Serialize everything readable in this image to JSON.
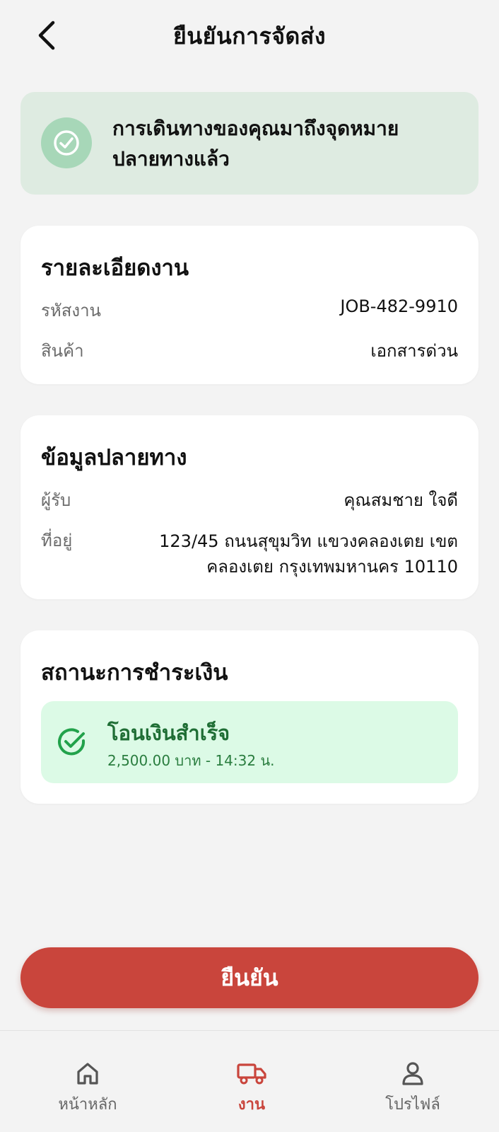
{
  "header": {
    "title": "ยืนยันการจัดส่ง",
    "back_icon": "chevron-left-icon"
  },
  "banner": {
    "icon": "check-circle-icon",
    "message": "การเดินทางของคุณมาถึงจุดหมายปลายทางแล้ว",
    "bg_color": "#deebe1"
  },
  "job_details": {
    "title": "รายละเอียดงาน",
    "rows": [
      {
        "label": "รหัสงาน",
        "value": "JOB-482-9910"
      },
      {
        "label": "สินค้า",
        "value": "เอกสารด่วน"
      }
    ]
  },
  "destination": {
    "title": "ข้อมูลปลายทาง",
    "recipient_label": "ผู้รับ",
    "recipient_value": "คุณสมชาย ใจดี",
    "address_label": "ที่อยู่",
    "address_value": "123/45 ถนนสุขุมวิท แขวงคลองเตย เขตคลองเตย กรุงเทพมหานคร 10110"
  },
  "payment": {
    "title": "สถานะการชำระเงิน",
    "status_icon": "check-circle-icon",
    "status_title": "โอนเงินสำเร็จ",
    "status_detail": "2,500.00 บาท - 14:32 น.",
    "status_color": "#1f6e35"
  },
  "confirm_button": {
    "label": "ยืนยัน",
    "color": "#c9453c"
  },
  "bottom_nav": {
    "items": [
      {
        "label": "หน้าหลัก",
        "icon": "home-icon",
        "active": false
      },
      {
        "label": "งาน",
        "icon": "truck-icon",
        "active": true
      },
      {
        "label": "โปรไฟล์",
        "icon": "user-icon",
        "active": false
      }
    ]
  }
}
